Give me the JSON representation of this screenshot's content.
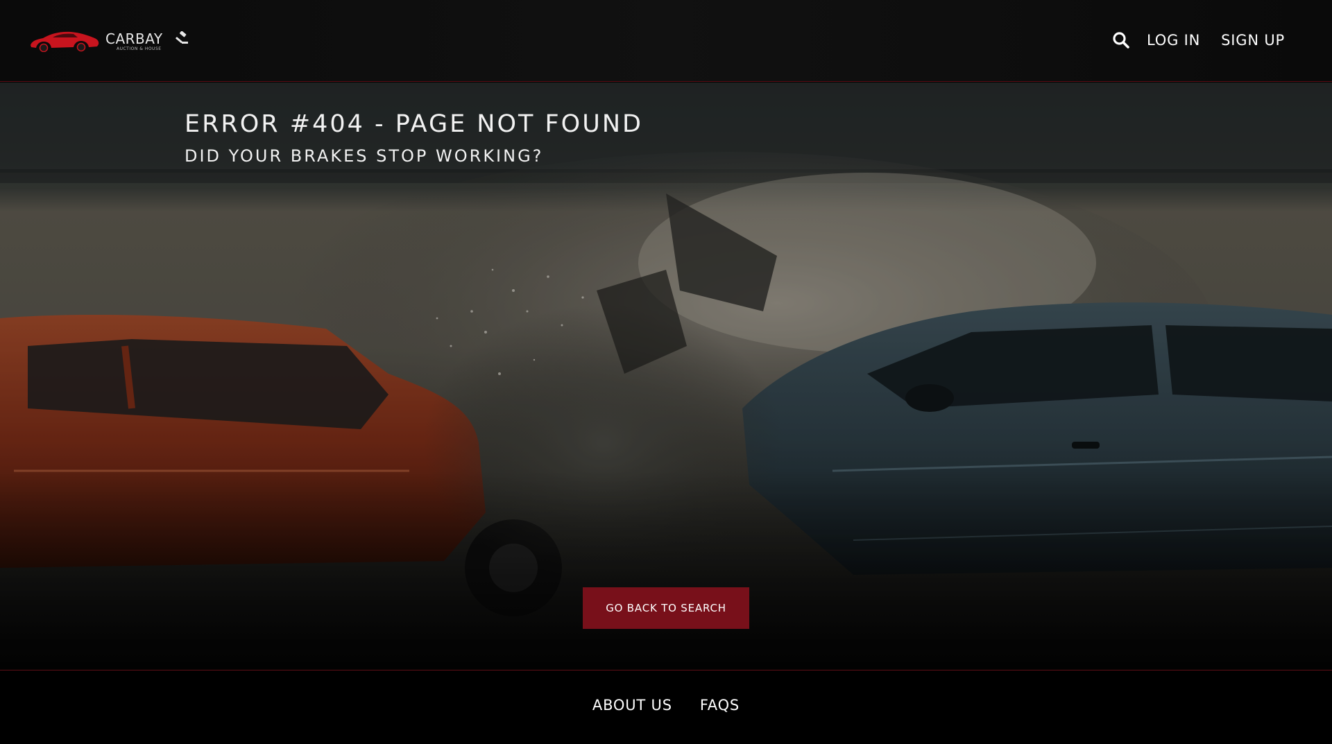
{
  "brand": {
    "name": "CARBAY",
    "tagline": "AUCTION & HOUSE",
    "logo_icon": "red-sports-car-icon",
    "gavel_icon": "gavel-icon",
    "accent_color": "#c8141e"
  },
  "header": {
    "search_icon": "search-icon",
    "nav": {
      "login_label": "LOG IN",
      "signup_label": "SIGN UP"
    }
  },
  "hero": {
    "title": "ERROR #404 - PAGE NOT FOUND",
    "subtitle": "DID YOUR BRAKES STOP WORKING?",
    "background": "car-crash-photo",
    "cta_label": "GO BACK TO SEARCH",
    "cta_color": "#78101a"
  },
  "footer": {
    "links": [
      "ABOUT US",
      "FAQS"
    ]
  }
}
